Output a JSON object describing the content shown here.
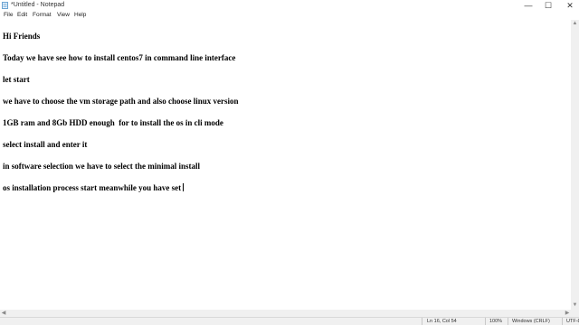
{
  "window": {
    "title": "*Untitled - Notepad",
    "minimize_glyph": "—",
    "maximize_glyph": "☐",
    "close_glyph": "✕",
    "icon": "notepad-icon"
  },
  "menu": {
    "items": [
      "File",
      "Edit",
      "Format",
      "View",
      "Help"
    ]
  },
  "editor": {
    "lines": [
      "Hi Friends",
      "Today we have see how to install centos7 in command line interface",
      "let start",
      "we have to choose the vm storage path and also choose linux version",
      "1GB ram and 8Gb HDD enough  for to install the os in cli mode",
      "select install and enter it",
      "in software selection we have to select the minimal install",
      "os installation process start meanwhile you have set"
    ]
  },
  "scrollbars": {
    "up": "▲",
    "down": "▼",
    "left": "◀",
    "right": "▶"
  },
  "status": {
    "position": "Ln 16, Col 54",
    "zoom": "100%",
    "line_ending": "Windows (CRLF)",
    "encoding": "UTF-8"
  }
}
